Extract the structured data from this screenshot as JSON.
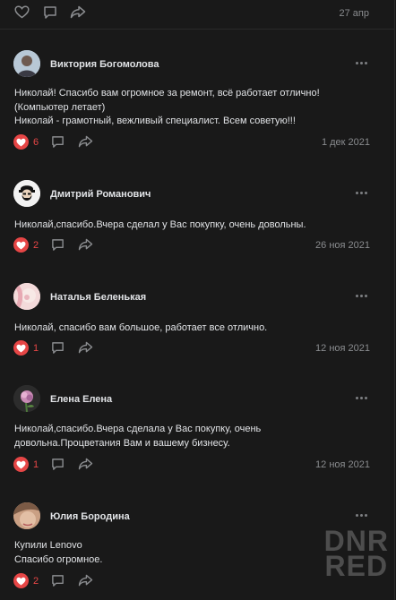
{
  "post": {
    "date": "27 апр"
  },
  "comments": [
    {
      "author": "Виктория Богомолова",
      "lines": [
        "Николай! Спасибо вам огромное за ремонт, всё работает отлично!",
        "(Компьютер летает)",
        "Николай - грамотный, вежливый специалист. Всем советую!!!"
      ],
      "likes": "6",
      "date": "1 дек 2021"
    },
    {
      "author": "Дмитрий Романович",
      "lines": [
        "Николай,спасибо.Вчера сделал у Вас покупку, очень довольны."
      ],
      "likes": "2",
      "date": "26 ноя 2021"
    },
    {
      "author": "Наталья Беленькая",
      "lines": [
        "Николай, спасибо вам большое, работает все отлично."
      ],
      "likes": "1",
      "date": "12 ноя 2021"
    },
    {
      "author": "Елена Елена",
      "lines": [
        "Николай,спасибо.Вчера сделала у Вас покупку, очень",
        "довольна.Процветания Вам и вашему бизнесу."
      ],
      "likes": "1",
      "date": "12 ноя 2021"
    },
    {
      "author": "Юлия Бородина",
      "lines": [
        "Купили Lenovo",
        "Спасибо огромное."
      ],
      "likes": "2",
      "date": ""
    }
  ],
  "watermark": {
    "line1": "DNR",
    "line2": "RED"
  },
  "colors": {
    "background": "#191919",
    "text": "#e1e3e6",
    "muted": "#8a8c8f",
    "like_active": "#e64646"
  },
  "icons": [
    "heart-icon",
    "comment-icon",
    "share-icon",
    "more-icon"
  ]
}
